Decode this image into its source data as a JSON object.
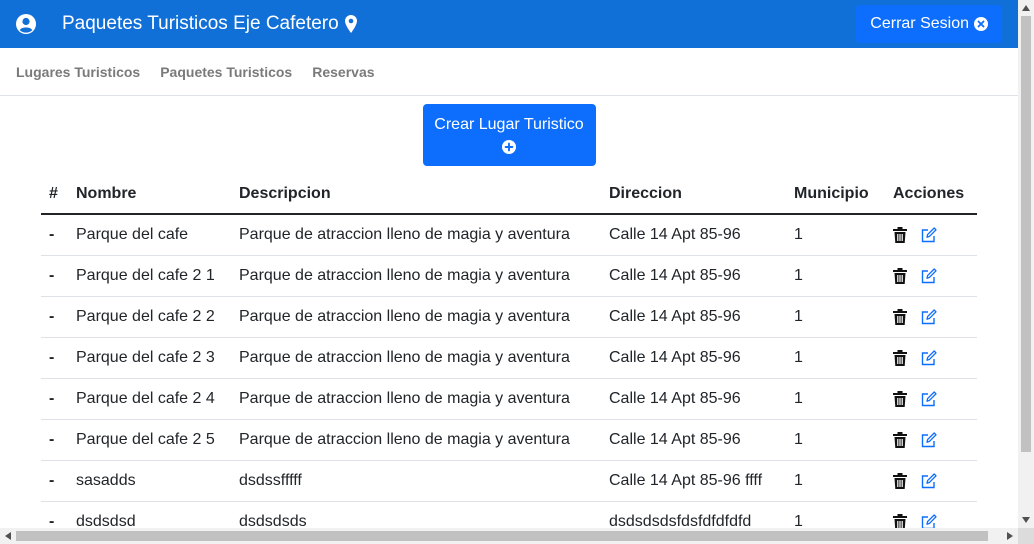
{
  "header": {
    "title": "Paquetes Turisticos Eje Cafetero",
    "logout_label": "Cerrar Sesion"
  },
  "nav": {
    "items": [
      {
        "label": "Lugares Turisticos"
      },
      {
        "label": "Paquetes Turisticos"
      },
      {
        "label": "Reservas"
      }
    ]
  },
  "create_button": {
    "label": "Crear Lugar Turistico"
  },
  "table": {
    "headers": {
      "num": "#",
      "nombre": "Nombre",
      "descripcion": "Descripcion",
      "direccion": "Direccion",
      "municipio": "Municipio",
      "acciones": "Acciones"
    },
    "rows": [
      {
        "num": "-",
        "nombre": "Parque del cafe",
        "descripcion": "Parque de atraccion lleno de magia y aventura",
        "direccion": "Calle 14 Apt 85-96",
        "municipio": "1"
      },
      {
        "num": "-",
        "nombre": "Parque del cafe 2 1",
        "descripcion": "Parque de atraccion lleno de magia y aventura",
        "direccion": "Calle 14 Apt 85-96",
        "municipio": "1"
      },
      {
        "num": "-",
        "nombre": "Parque del cafe 2 2",
        "descripcion": "Parque de atraccion lleno de magia y aventura",
        "direccion": "Calle 14 Apt 85-96",
        "municipio": "1"
      },
      {
        "num": "-",
        "nombre": "Parque del cafe 2 3",
        "descripcion": "Parque de atraccion lleno de magia y aventura",
        "direccion": "Calle 14 Apt 85-96",
        "municipio": "1"
      },
      {
        "num": "-",
        "nombre": "Parque del cafe 2 4",
        "descripcion": "Parque de atraccion lleno de magia y aventura",
        "direccion": "Calle 14 Apt 85-96",
        "municipio": "1"
      },
      {
        "num": "-",
        "nombre": "Parque del cafe 2 5",
        "descripcion": "Parque de atraccion lleno de magia y aventura",
        "direccion": "Calle 14 Apt 85-96",
        "municipio": "1"
      },
      {
        "num": "-",
        "nombre": "sasadds",
        "descripcion": "dsdssfffff",
        "direccion": "Calle 14 Apt 85-96 ffff",
        "municipio": "1"
      },
      {
        "num": "-",
        "nombre": "dsdsdsd",
        "descripcion": "dsdsdsds",
        "direccion": "dsdsdsdsfdsfdfdfdfd",
        "municipio": "1"
      }
    ]
  },
  "icons": {
    "user": "user-circle-icon",
    "pin": "map-pin-icon",
    "logout": "x-circle-icon",
    "create": "plus-circle-icon",
    "delete": "trash-icon",
    "edit": "edit-icon"
  },
  "colors": {
    "header_bg": "#1170d8",
    "primary": "#0d6efd",
    "edit_icon": "#0d6efd"
  }
}
